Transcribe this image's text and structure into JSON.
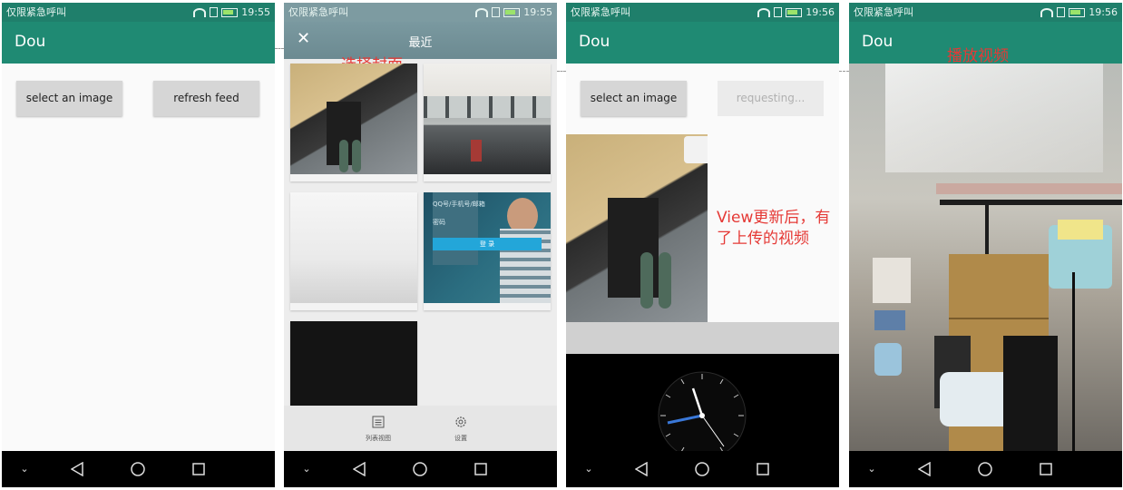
{
  "status_bar": {
    "carrier": "仅限紧急呼叫",
    "times": [
      "19:55",
      "19:55",
      "19:56",
      "19:56"
    ]
  },
  "app": {
    "title": "Dou"
  },
  "screen1": {
    "select_button": "select an image",
    "refresh_button": "refresh feed"
  },
  "screen2": {
    "title": "最近",
    "annotation": "选择封面",
    "login_overlay": {
      "account_placeholder": "QQ号/手机号/邮箱",
      "password_label": "密码",
      "login_button": "登 录"
    },
    "bottom_bar": {
      "list_view": "列表视图",
      "settings": "设置"
    }
  },
  "screen3": {
    "select_button": "select an image",
    "requesting_button": "requesting...",
    "annotation": "View更新后，有了上传的视频"
  },
  "screen4": {
    "annotation": "播放视频"
  },
  "colors": {
    "accent": "#1f8a73",
    "status_bar": "#1f7f6b",
    "annotation_red": "#e53935"
  }
}
